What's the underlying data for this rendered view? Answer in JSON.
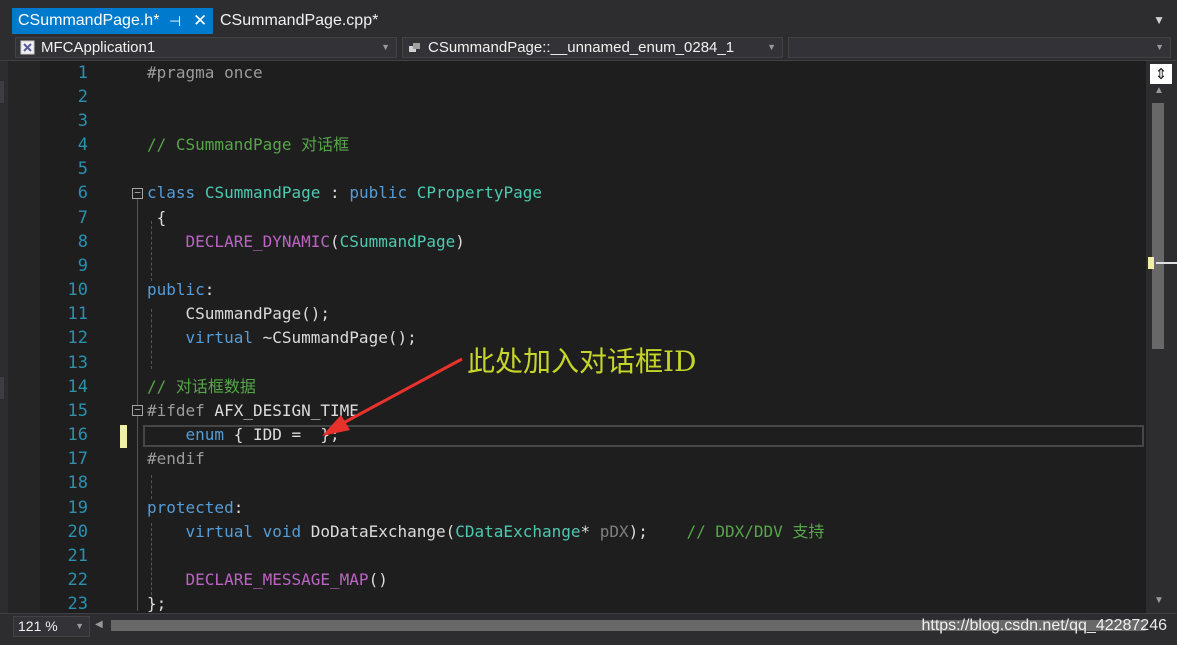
{
  "tabs": [
    {
      "label": "CSummandPage.h*",
      "active": true
    },
    {
      "label": "CSummandPage.cpp*",
      "active": false
    }
  ],
  "navbar": {
    "project": "MFCApplication1",
    "scope": "CSummandPage::__unnamed_enum_0284_1",
    "member": ""
  },
  "editor": {
    "line_numbers": [
      "1",
      "2",
      "3",
      "4",
      "5",
      "6",
      "7",
      "8",
      "9",
      "10",
      "11",
      "12",
      "13",
      "14",
      "15",
      "16",
      "17",
      "18",
      "19",
      "20",
      "21",
      "22",
      "23"
    ],
    "current_line": 16
  },
  "code": {
    "l1_pp": "#pragma once",
    "l4_cm": "// CSummandPage 对话框",
    "l6_kw1": "class",
    "l6_ty1": "CSummandPage",
    "l6_tx1": " : ",
    "l6_kw2": "public",
    "l6_ty2": "CPropertyPage",
    "l7": "{",
    "l8_mc": "DECLARE_DYNAMIC",
    "l8_p1": "(",
    "l8_ty": "CSummandPage",
    "l8_p2": ")",
    "l10_kw": "public",
    "l10_tx": ":",
    "l11": "CSummandPage();",
    "l12_kw": "virtual",
    "l12_tx": " ~CSummandPage();",
    "l14_cm": "// 对话框数据",
    "l15_pp": "#ifdef",
    "l15_tx": " AFX_DESIGN_TIME",
    "l16_kw": "enum",
    "l16_tx": " { IDD =  };",
    "l17_pp": "#endif",
    "l19_kw": "protected",
    "l19_tx": ":",
    "l20_kw1": "virtual",
    "l20_kw2": "void",
    "l20_tx1": " DoDataExchange(",
    "l20_ty": "CDataExchange",
    "l20_tx2": "* ",
    "l20_pr": "pDX",
    "l20_tx3": ");",
    "l20_cm": "// DDX/DDV 支持",
    "l22_mc": "DECLARE_MESSAGE_MAP",
    "l22_tx": "()",
    "l23": "};"
  },
  "annotation": {
    "text": "此处加入对话框ID",
    "color": "#c5d52a",
    "arrow_color": "#e8322b"
  },
  "statusbar": {
    "zoom": "121 %",
    "watermark": "https://blog.csdn.net/qq_42287246"
  },
  "colors": {
    "accent": "#007acc",
    "line_number": "#2b91af",
    "keyword": "#569cd6",
    "type": "#4ec9b0",
    "comment": "#57a64a",
    "macro": "#bd63c5",
    "change_marker": "#efefa6"
  },
  "icons": [
    "pin-icon",
    "close-icon",
    "project-icon",
    "scope-icon",
    "split-editor-icon",
    "dropdown-arrow-icon",
    "scroll-arrow-icon"
  ]
}
